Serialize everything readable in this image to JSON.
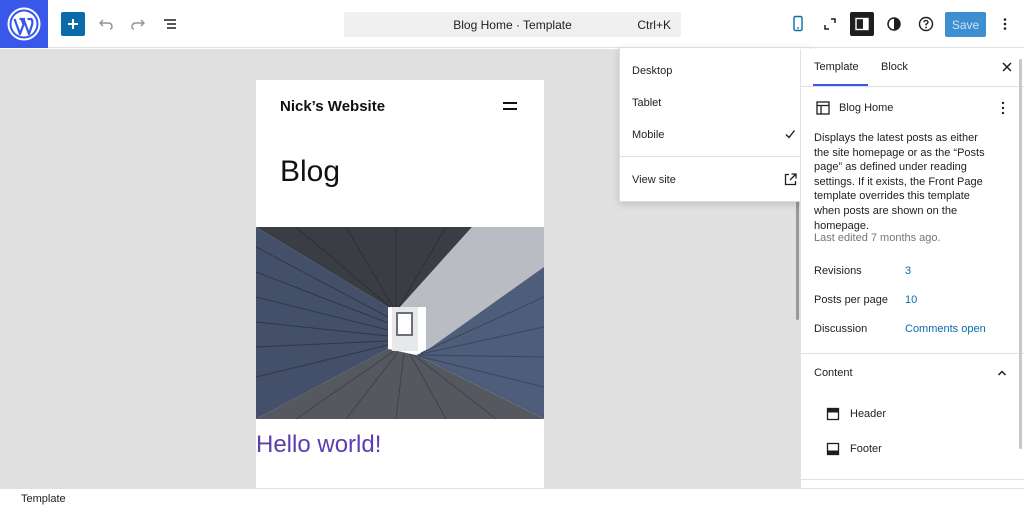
{
  "toolbar": {
    "logo": "wordpress-icon",
    "add_icon": "plus-icon",
    "undo_icon": "undo-icon",
    "redo_icon": "redo-icon",
    "list_view_icon": "list-view-icon",
    "command_title": "Blog Home · Template",
    "command_shortcut": "Ctrl+K",
    "device_icon": "mobile-icon",
    "fullscreen_icon": "expand-icon",
    "settings_icon": "sidebar-toggle-icon",
    "styles_icon": "half-circle-icon",
    "help_icon": "help-icon",
    "save_label": "Save",
    "options_icon": "more-vertical-icon"
  },
  "canvas": {
    "site_title": "Nick’s Website",
    "heading": "Blog",
    "post_title": "Hello world!"
  },
  "device_menu": {
    "items": [
      "Desktop",
      "Tablet",
      "Mobile"
    ],
    "selected": "Mobile",
    "view_site": "View site"
  },
  "sidebar": {
    "tabs": [
      "Template",
      "Block"
    ],
    "active_tab": "Template",
    "template_name": "Blog Home",
    "description": "Displays the latest posts as either the site homepage or as the “Posts page” as defined under reading settings. If it exists, the Front Page template overrides this template when posts are shown on the homepage.",
    "last_edited": "Last edited 7 months ago.",
    "meta": [
      {
        "label": "Revisions",
        "value": "3"
      },
      {
        "label": "Posts per page",
        "value": "10"
      },
      {
        "label": "Discussion",
        "value": "Comments open"
      }
    ],
    "content_heading": "Content",
    "template_parts": [
      "Header",
      "Footer"
    ]
  },
  "footer": {
    "label": "Template"
  },
  "colors": {
    "wp_blue": "#3858e9",
    "accent": "#0a6ba8",
    "post_title": "#5b3eb0"
  }
}
